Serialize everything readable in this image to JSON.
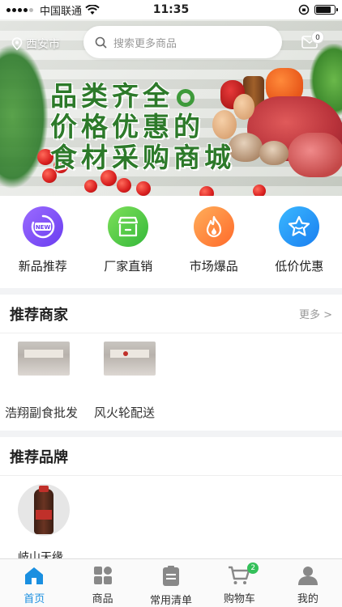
{
  "status_bar": {
    "carrier": "中国联通",
    "time": "11:35"
  },
  "header": {
    "location": "西安市",
    "search_placeholder": "搜索更多商品",
    "message_count": "0"
  },
  "banner": {
    "slogan_lines": [
      "品类齐全",
      "价格优惠的",
      "食材采购商城"
    ]
  },
  "categories": [
    {
      "label": "新品推荐",
      "icon": "new-badge-icon",
      "color": "#7a4cf5"
    },
    {
      "label": "厂家直销",
      "icon": "store-icon",
      "color": "#3cbf3a"
    },
    {
      "label": "市场爆品",
      "icon": "flame-icon",
      "color": "#ff7a2e"
    },
    {
      "label": "低价优惠",
      "icon": "star-icon",
      "color": "#2090f5"
    }
  ],
  "merchants": {
    "title": "推荐商家",
    "more": "更多 >",
    "items": [
      {
        "name": "浩翔副食批发"
      },
      {
        "name": "风火轮配送"
      }
    ]
  },
  "brands": {
    "title": "推荐品牌",
    "items": [
      {
        "name": "岐山天缘"
      }
    ]
  },
  "tabbar": {
    "items": [
      {
        "label": "首页",
        "icon": "home-icon",
        "active": true
      },
      {
        "label": "商品",
        "icon": "grid-icon",
        "active": false
      },
      {
        "label": "常用清单",
        "icon": "list-icon",
        "active": false
      },
      {
        "label": "购物车",
        "icon": "cart-icon",
        "active": false,
        "badge": "2"
      },
      {
        "label": "我的",
        "icon": "user-icon",
        "active": false
      }
    ]
  },
  "colors": {
    "accent": "#1a8fe0",
    "brand_green": "#2d7a2a"
  }
}
